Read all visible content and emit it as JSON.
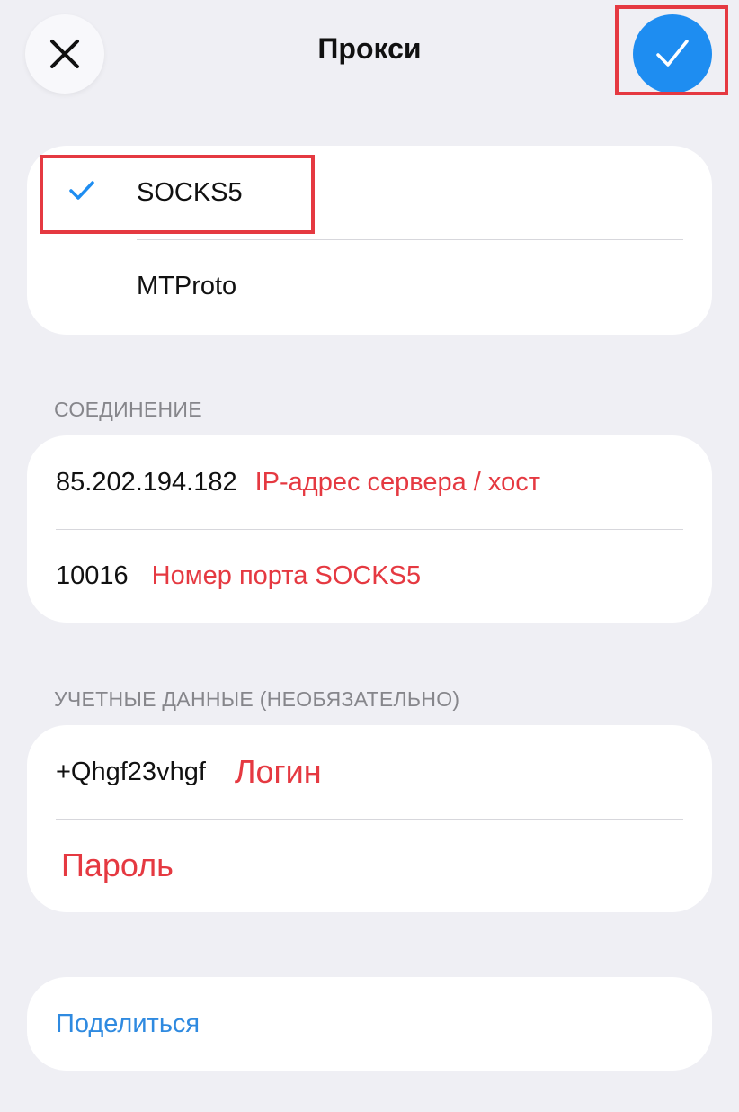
{
  "header": {
    "title": "Прокси",
    "close_icon": "close-icon",
    "confirm_icon": "checkmark-icon"
  },
  "proxy_type": {
    "options": [
      {
        "label": "SOCKS5",
        "selected": true
      },
      {
        "label": "MTProto",
        "selected": false
      }
    ]
  },
  "connection": {
    "header": "СОЕДИНЕНИЕ",
    "server_value": "85.202.194.182",
    "server_annotation": "IP-адрес сервера / хост",
    "port_value": "10016",
    "port_annotation": "Номер порта SOCKS5"
  },
  "credentials": {
    "header": "УЧЕТНЫЕ ДАННЫЕ (НЕОБЯЗАТЕЛЬНО)",
    "login_value": "+Qhgf23vhgf",
    "login_annotation": "Логин",
    "password_annotation": "Пароль"
  },
  "share": {
    "label": "Поделиться"
  },
  "colors": {
    "accent": "#1e8df1",
    "annotation": "#e53941",
    "background": "#efeff4",
    "link": "#2f8ae0"
  }
}
